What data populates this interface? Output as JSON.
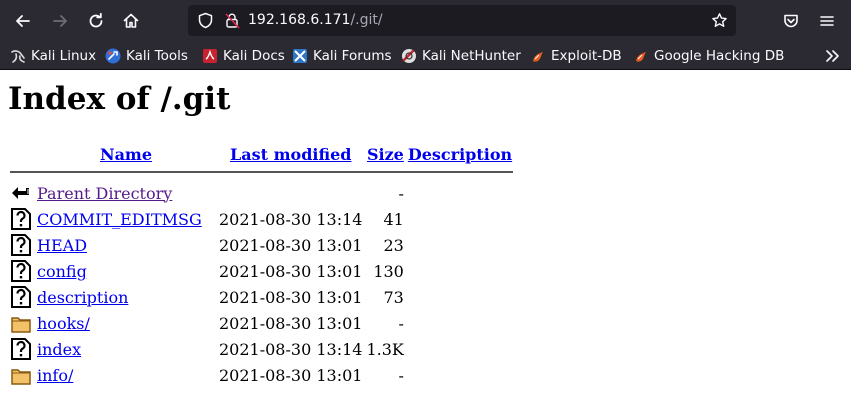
{
  "browser": {
    "url_host": "192.168.6.171",
    "url_path": "/.git/",
    "bookmarks": [
      {
        "label": "Kali Linux",
        "icon": "kali-dragon-icon"
      },
      {
        "label": "Kali Tools",
        "icon": "kali-tools-icon"
      },
      {
        "label": "Kali Docs",
        "icon": "kali-docs-icon"
      },
      {
        "label": "Kali Forums",
        "icon": "kali-forums-icon"
      },
      {
        "label": "Kali NetHunter",
        "icon": "kali-nethunter-icon"
      },
      {
        "label": "Exploit-DB",
        "icon": "exploit-db-icon"
      },
      {
        "label": "Google Hacking DB",
        "icon": "google-hacking-db-icon"
      }
    ]
  },
  "page": {
    "title": "Index of /.git",
    "columns": {
      "name": "Name",
      "last_modified": "Last modified",
      "size": "Size",
      "description": "Description"
    },
    "rows": [
      {
        "name": "Parent Directory",
        "modified": "",
        "size": "-",
        "type": "parent",
        "visited": true
      },
      {
        "name": "COMMIT_EDITMSG",
        "modified": "2021-08-30 13:14",
        "size": "41",
        "type": "file"
      },
      {
        "name": "HEAD",
        "modified": "2021-08-30 13:01",
        "size": "23",
        "type": "file"
      },
      {
        "name": "config",
        "modified": "2021-08-30 13:01",
        "size": "130",
        "type": "file"
      },
      {
        "name": "description",
        "modified": "2021-08-30 13:01",
        "size": "73",
        "type": "file"
      },
      {
        "name": "hooks/",
        "modified": "2021-08-30 13:01",
        "size": "-",
        "type": "folder"
      },
      {
        "name": "index",
        "modified": "2021-08-30 13:14",
        "size": "1.3K",
        "type": "file"
      },
      {
        "name": "info/",
        "modified": "2021-08-30 13:01",
        "size": "-",
        "type": "folder"
      }
    ]
  },
  "colors": {
    "toolbar_bg": "#2b2a33",
    "urlbar_bg": "#1c1b22",
    "link": "#0000ee",
    "visited_link": "#551a8b"
  }
}
